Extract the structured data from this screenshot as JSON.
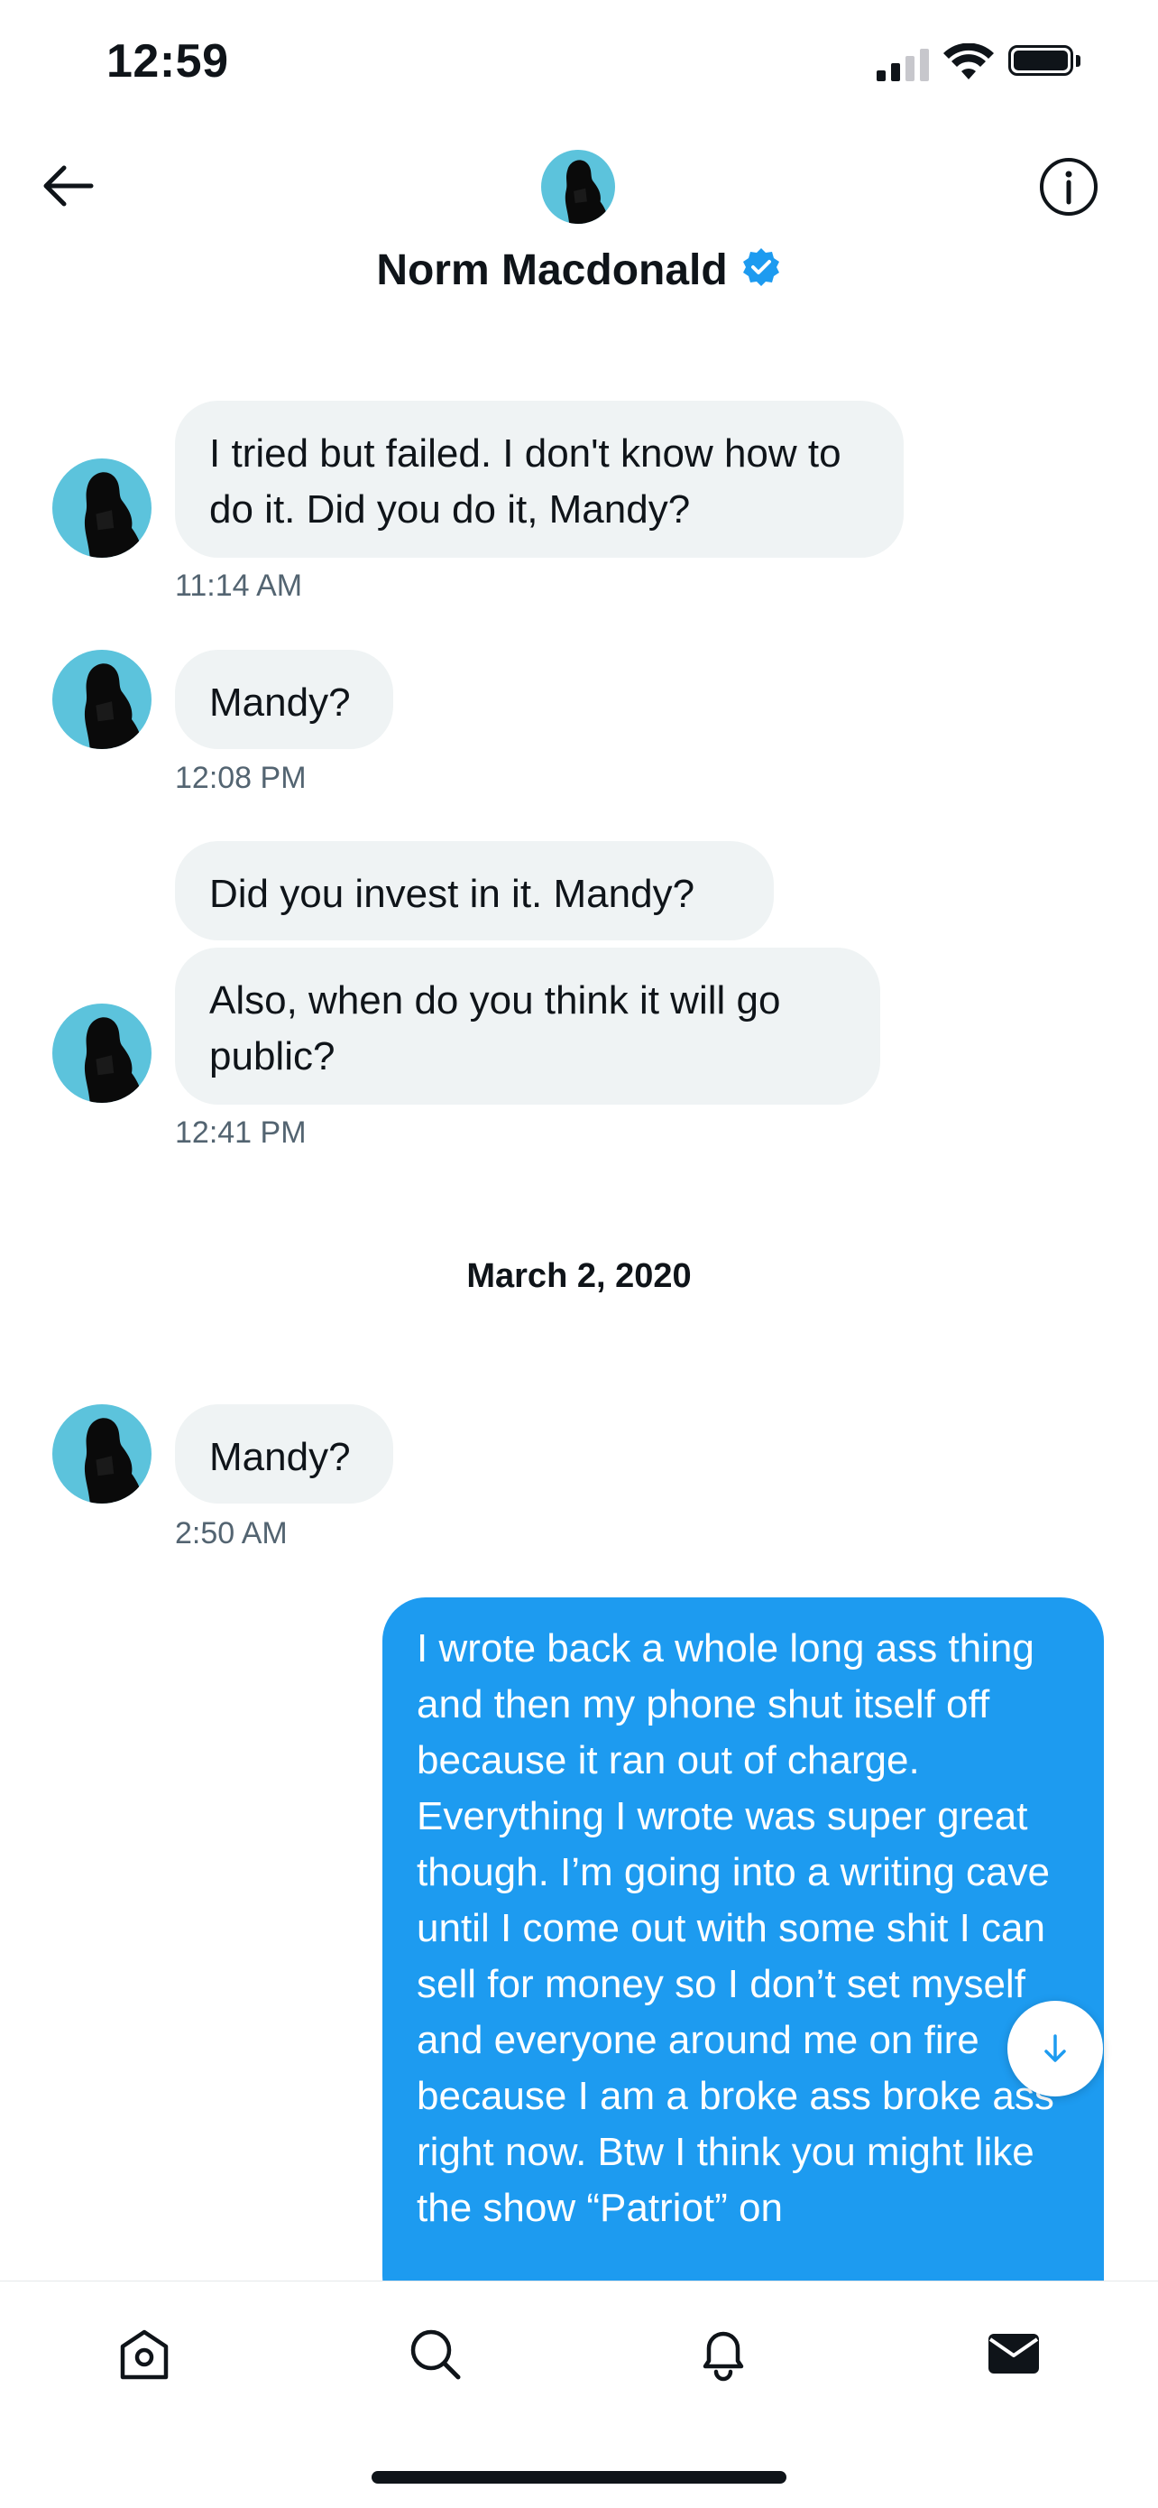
{
  "status_bar": {
    "time": "12:59"
  },
  "header": {
    "name": "Norm Macdonald",
    "verified": true
  },
  "icons": {
    "back": "back-arrow-icon",
    "info": "info-icon",
    "verified": "verified-badge-icon",
    "scroll_down": "arrow-down-icon",
    "home": "home-icon",
    "search": "search-icon",
    "notifications": "bell-icon",
    "messages": "mail-icon"
  },
  "messages": [
    {
      "text": "I tried but failed. I don't know how to do it. Did you do it, Mandy?",
      "time": "11:14 AM"
    },
    {
      "text": "Mandy?",
      "time": "12:08 PM"
    },
    {
      "text": "Did you invest in it. Mandy?"
    },
    {
      "text": "Also, when do you think it will go public?",
      "time": "12:41 PM"
    },
    {
      "text": "Mandy?",
      "time": "2:50 AM"
    }
  ],
  "date_separator": "March 2, 2020",
  "outgoing": {
    "text": "I wrote back a whole long ass thing and then my phone shut itself off because it ran out of charge. Everything I wrote was super great though. I’m going into a writing cave until I come out with some shit I can sell for money so I don’t set myself and everyone around me on fire because I am a broke ass broke ass right now. Btw I think you might like the show “Patriot” on"
  },
  "colors": {
    "accent": "#1d9bf0",
    "incoming_bubble": "#eff3f4",
    "secondary_text": "#536471"
  }
}
